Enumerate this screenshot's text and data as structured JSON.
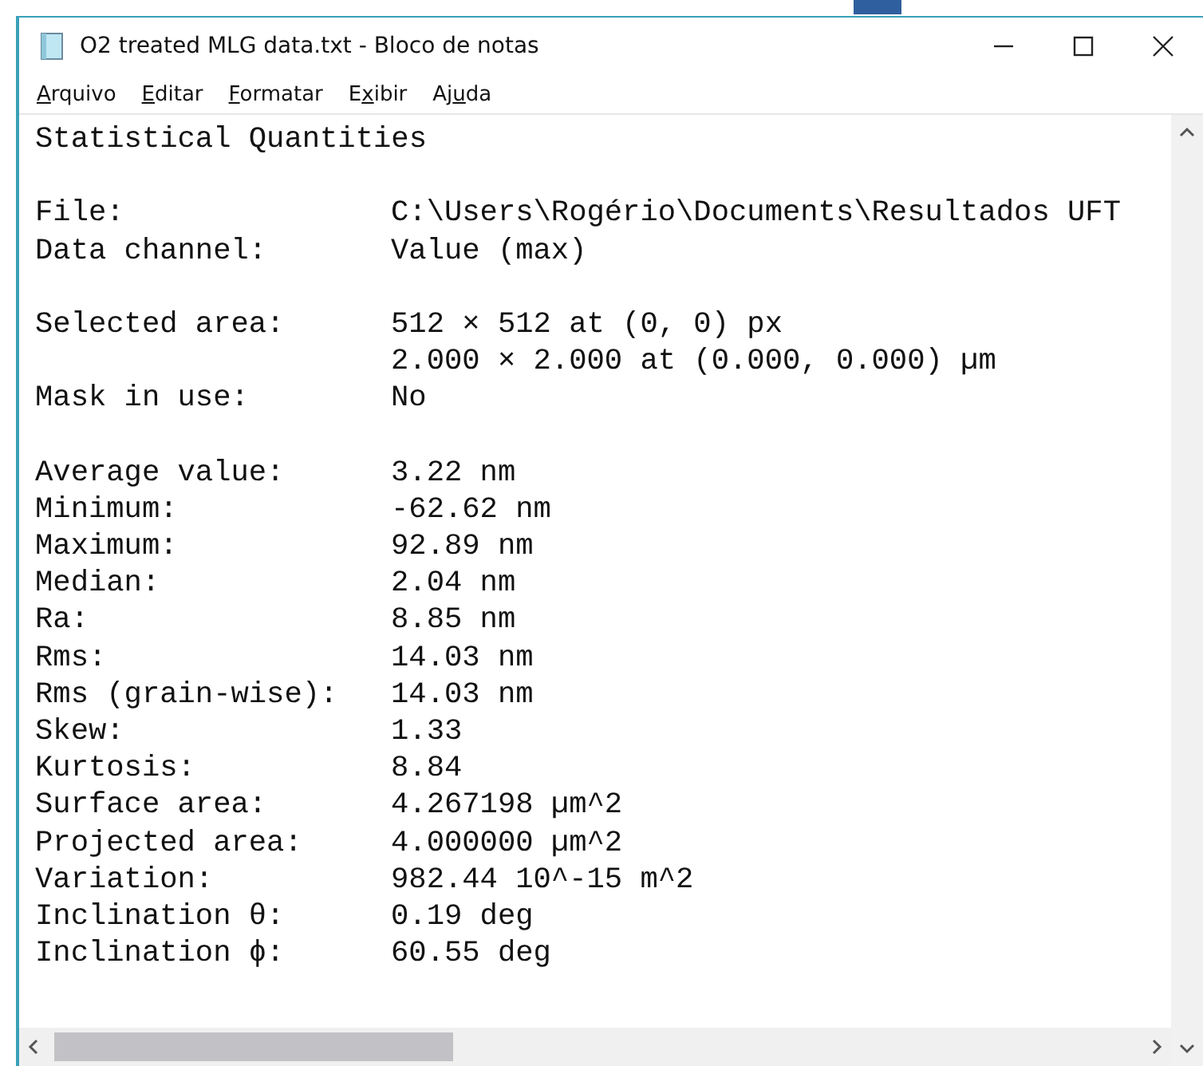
{
  "window": {
    "title": "O2 treated MLG data.txt - Bloco de notas"
  },
  "menu": [
    {
      "key": "A",
      "after": "rquivo"
    },
    {
      "key": "E",
      "after": "ditar"
    },
    {
      "key": "F",
      "after": "ormatar"
    },
    {
      "before": "E",
      "key": "x",
      "after": "ibir"
    },
    {
      "before": "Aj",
      "key": "u",
      "after": "da"
    }
  ],
  "lines": [
    {
      "kind": "heading",
      "text": "Statistical Quantities"
    },
    {
      "kind": "blank"
    },
    {
      "kind": "field",
      "label": "File:",
      "value": "C:\\Users\\Rogério\\Documents\\Resultados UFT"
    },
    {
      "kind": "field",
      "label": "Data channel:",
      "value": "Value (max)"
    },
    {
      "kind": "blank"
    },
    {
      "kind": "field",
      "label": "Selected area:",
      "value": "512 × 512 at (0, 0) px"
    },
    {
      "kind": "field",
      "value": "2.000 × 2.000 at (0.000, 0.000) µm"
    },
    {
      "kind": "field",
      "label": "Mask in use:",
      "value": "No"
    },
    {
      "kind": "blank"
    },
    {
      "kind": "field",
      "label": "Average value:",
      "value": "3.22 nm"
    },
    {
      "kind": "field",
      "label": "Minimum:",
      "value": "-62.62 nm"
    },
    {
      "kind": "field",
      "label": "Maximum:",
      "value": "92.89 nm"
    },
    {
      "kind": "field",
      "label": "Median:",
      "value": "2.04 nm"
    },
    {
      "kind": "field",
      "label": "Ra:",
      "value": "8.85 nm"
    },
    {
      "kind": "field",
      "label": "Rms:",
      "value": "14.03 nm"
    },
    {
      "kind": "field",
      "label": "Rms (grain-wise):",
      "value": "14.03 nm"
    },
    {
      "kind": "field",
      "label": "Skew:",
      "value": "1.33"
    },
    {
      "kind": "field",
      "label": "Kurtosis:",
      "value": "8.84"
    },
    {
      "kind": "field",
      "label": "Surface area:",
      "value": "4.267198 µm^2"
    },
    {
      "kind": "field",
      "label": "Projected area:",
      "value": "4.000000 µm^2"
    },
    {
      "kind": "field",
      "label": "Variation:",
      "value": "982.44 10^-15 m^2"
    },
    {
      "kind": "field",
      "label": "Inclination θ:",
      "value": "0.19 deg"
    },
    {
      "kind": "field",
      "label": "Inclination ϕ:",
      "value": "60.55 deg"
    }
  ]
}
